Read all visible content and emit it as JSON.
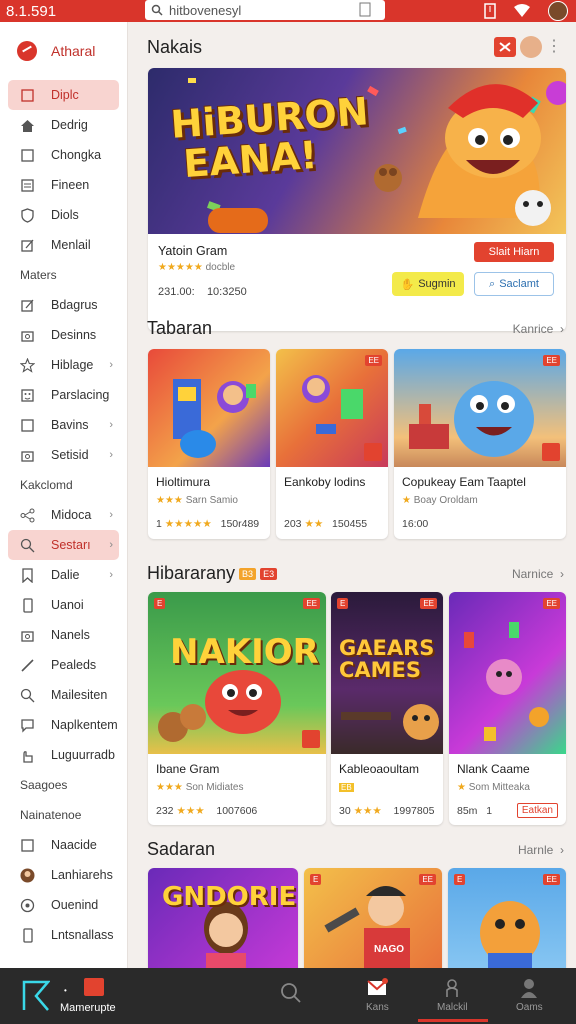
{
  "status_bar": {
    "time": "8.1.591",
    "search_placeholder": "hitbovenesyl"
  },
  "sidebar": {
    "brand": "Atharal",
    "items_top": [
      {
        "label": "Diplc",
        "icon": "square-icon",
        "active": true
      },
      {
        "label": "Dedrig",
        "icon": "home-icon"
      },
      {
        "label": "Chongka",
        "icon": "square-icon"
      },
      {
        "label": "Fineen",
        "icon": "list-icon"
      },
      {
        "label": "Diols",
        "icon": "shield-icon"
      },
      {
        "label": "Menlail",
        "icon": "edit-icon"
      }
    ],
    "section1": "Maters",
    "items_mid": [
      {
        "label": "Bdagrus",
        "icon": "edit-icon"
      },
      {
        "label": "Desinns",
        "icon": "camera-icon"
      },
      {
        "label": "Hiblage",
        "icon": "star-icon",
        "chevron": true
      },
      {
        "label": "Parslacing",
        "icon": "grid-icon"
      },
      {
        "label": "Bavins",
        "icon": "square-icon",
        "chevron": true
      },
      {
        "label": "Setisid",
        "icon": "camera-icon",
        "chevron": true
      }
    ],
    "section2": "Kakclomd",
    "items_low": [
      {
        "label": "Midoca",
        "icon": "share-icon",
        "chevron": true
      },
      {
        "label": "Sestarı",
        "icon": "search-icon",
        "active": true,
        "chevron": true
      },
      {
        "label": "Dalie",
        "icon": "bookmark-icon",
        "chevron": true
      },
      {
        "label": "Uanoi",
        "icon": "phone-icon"
      },
      {
        "label": "Nanels",
        "icon": "camera-icon"
      },
      {
        "label": "Pealeds",
        "icon": "pen-icon"
      },
      {
        "label": "Mailesiten",
        "icon": "search-icon"
      },
      {
        "label": "Naplkentem",
        "icon": "chat-icon"
      },
      {
        "label": "Luguurradb",
        "icon": "hand-icon"
      }
    ],
    "section3": "Saagoes",
    "section4": "Nainatenoe",
    "items_bottom": [
      {
        "label": "Naacide",
        "icon": "square-icon"
      },
      {
        "label": "Lanhiarehs",
        "icon": "avatar-icon"
      },
      {
        "label": "Ouenind",
        "icon": "globe-icon"
      },
      {
        "label": "Lntsnallass",
        "icon": "phone-icon"
      }
    ]
  },
  "main": {
    "section1_title": "Nakais",
    "hero": {
      "art_text_line1": "HiBURON",
      "art_text_line2": "EANA!",
      "title": "Yatoin Gram",
      "subtitle": "docble",
      "meta_left": "231.00:",
      "meta_right": "10:3250",
      "start_button": "Slait Hiarn",
      "signup_button": "Sugmin",
      "search_button": "Saclamt"
    },
    "section2": {
      "title": "Tabaran",
      "more": "Kanrice",
      "cards": [
        {
          "title": "Hioltimura",
          "sub": "Sarn Samio",
          "meta": "150r489",
          "stars_left": "1"
        },
        {
          "title": "Eankoby lodins",
          "sub": "",
          "meta": "150455",
          "stars_left": "203"
        },
        {
          "title": "Copukeay Eam Taaptel",
          "sub": "Boay Oroldam",
          "meta": "16:00",
          "stars_left": ""
        }
      ]
    },
    "section3": {
      "title": "Hibararany",
      "tag1": "B3",
      "tag2": "E3",
      "more": "Narnice",
      "cards": [
        {
          "art": "NAKIOR",
          "title": "Ibane Gram",
          "sub": "Son Midiates",
          "meta_left": "232",
          "meta_right": "1007606"
        },
        {
          "art_line1": "GAEARS",
          "art_line2": "CAMES",
          "title": "Kableoaoultam",
          "sub": "",
          "meta_left": "30",
          "meta_right": "1997805"
        },
        {
          "title": "Nlank Caame",
          "sub": "Som Mitteaka",
          "meta_left": "85m",
          "meta_right": "1",
          "button": "Eatkan"
        }
      ]
    },
    "section4": {
      "title": "Sadaran",
      "more": "Harnle",
      "cards": [
        {
          "art": "GNDORIEN"
        },
        {
          "shirt": "NAGO"
        },
        {}
      ]
    }
  },
  "bottom_nav": {
    "brand": "Mamerupte",
    "items": [
      {
        "label": "",
        "icon": "search-icon"
      },
      {
        "label": "Kans",
        "icon": "mail-icon"
      },
      {
        "label": "Malckil",
        "icon": "person-icon",
        "active": true
      },
      {
        "label": "Oams",
        "icon": "user-icon"
      }
    ]
  },
  "colors": {
    "accent": "#d9352b",
    "active_bg": "#f8d4d0",
    "bottom_bar": "#2a2a2a"
  }
}
